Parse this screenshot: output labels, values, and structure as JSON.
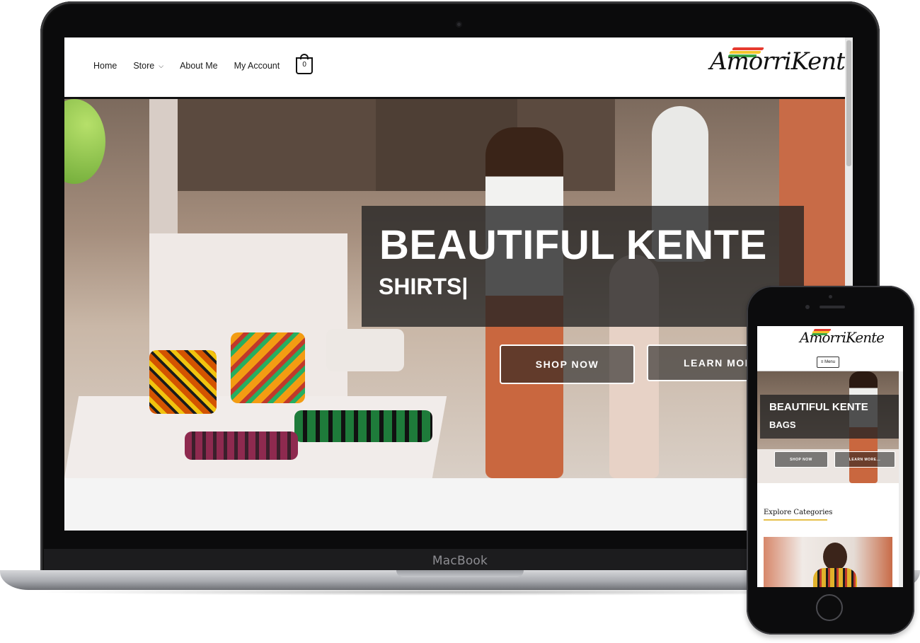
{
  "laptop": {
    "brand_label": "MacBook",
    "site": {
      "nav": {
        "items": [
          {
            "label": "Home"
          },
          {
            "label": "Store",
            "has_dropdown": true
          },
          {
            "label": "About Me"
          },
          {
            "label": "My Account"
          }
        ],
        "cart_count": "0"
      },
      "logo_text": "AmorriKente",
      "hero": {
        "title": "BEAUTIFUL KENTE",
        "subtitle": "SHIRTS|",
        "buttons": {
          "shop": "SHOP NOW",
          "learn": "LEARN MOR"
        }
      }
    }
  },
  "phone": {
    "logo_text": "AmorriKente",
    "menu_label": "≡ Menu",
    "hero": {
      "title": "BEAUTIFUL KENTE",
      "subtitle": "BAGS",
      "buttons": {
        "shop": "SHOP NOW",
        "learn": "LEARN MORE..."
      }
    },
    "section_title": "Explore Categories"
  },
  "colors": {
    "logo_stripes": [
      "#e63a2f",
      "#f4c52b",
      "#3aa545"
    ],
    "accent_underline": "#e6c04c",
    "overlay": "#232323"
  }
}
